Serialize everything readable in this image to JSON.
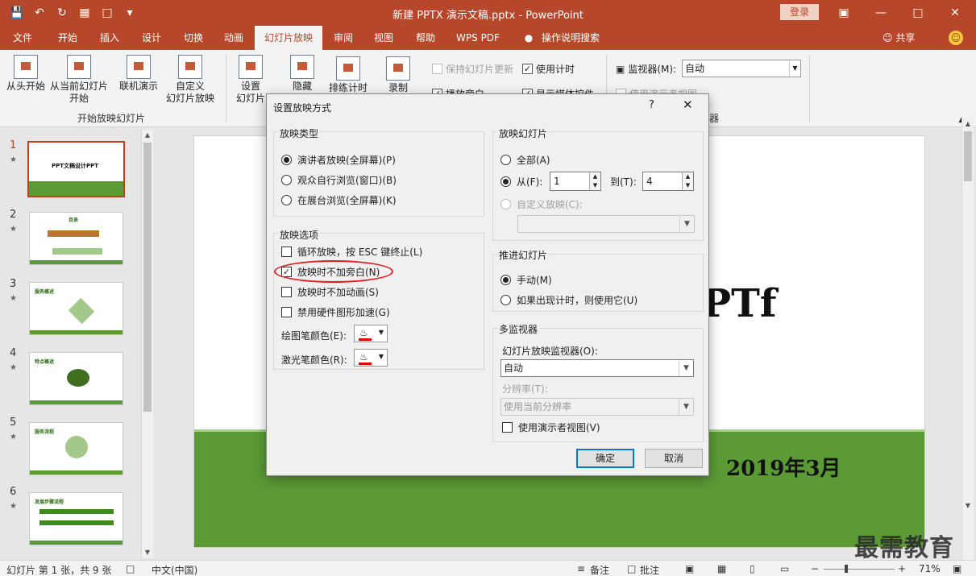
{
  "titlebar": {
    "title": "新建 PPTX 演示文稿.pptx - PowerPoint",
    "login": "登录"
  },
  "tabs": [
    "文件",
    "开始",
    "插入",
    "设计",
    "切换",
    "动画",
    "幻灯片放映",
    "审阅",
    "视图",
    "帮助",
    "WPS PDF",
    "操作说明搜索"
  ],
  "share": "共享",
  "ribbon": {
    "from_start": "从头开始",
    "from_current_1": "从当前幻灯片",
    "from_current_2": "开始",
    "online": "联机演示",
    "custom_1": "自定义",
    "custom_2": "幻灯片放映",
    "group_start": "开始放映幻灯片",
    "setup_1": "设置",
    "setup_2": "幻灯片",
    "hide": "隐藏",
    "rehearse": "排练计时",
    "record": "录制",
    "keep_updated": "保持幻灯片更新",
    "use_timings": "使用计时",
    "play_narration": "播放旁白",
    "show_media": "显示媒体控件",
    "monitor_label": "监视器(M):",
    "monitor_value": "自动",
    "presenter_view": "使用演示者视图",
    "group_monitor": "器"
  },
  "slides": [
    {
      "num": "1",
      "title": "PPT文稿设计PPT"
    },
    {
      "num": "2",
      "title": "目录"
    },
    {
      "num": "3",
      "title": "服务概述"
    },
    {
      "num": "4",
      "title": "特点概述"
    },
    {
      "num": "5",
      "title": "服务流程"
    },
    {
      "num": "6",
      "title": "发展步骤流程"
    }
  ],
  "slide": {
    "title_partial": "PTf",
    "date": "2019年3月"
  },
  "dialog": {
    "title": "设置放映方式",
    "help": "?",
    "show_type": {
      "legend": "放映类型",
      "opt1": "演讲者放映(全屏幕)(P)",
      "opt2": "观众自行浏览(窗口)(B)",
      "opt3": "在展台浏览(全屏幕)(K)"
    },
    "show_options": {
      "legend": "放映选项",
      "loop": "循环放映，按 ESC 键终止(L)",
      "no_narration": "放映时不加旁白(N)",
      "no_animation": "放映时不加动画(S)",
      "no_hw_accel": "禁用硬件图形加速(G)",
      "pen_color": "绘图笔颜色(E):",
      "laser_color": "激光笔颜色(R):"
    },
    "show_slides": {
      "legend": "放映幻灯片",
      "all": "全部(A)",
      "from": "从(F):",
      "from_value": "1",
      "to": "到(T):",
      "to_value": "4",
      "custom": "自定义放映(C):"
    },
    "advance": {
      "legend": "推进幻灯片",
      "manual": "手动(M)",
      "timings": "如果出现计时，则使用它(U)"
    },
    "multimonitor": {
      "legend": "多监视器",
      "monitor_label": "幻灯片放映监视器(O):",
      "monitor_value": "自动",
      "resolution_label": "分辨率(T):",
      "resolution_value": "使用当前分辨率",
      "presenter_view": "使用演示者视图(V)"
    },
    "ok": "确定",
    "cancel": "取消"
  },
  "statusbar": {
    "slide_info": "幻灯片 第 1 张，共 9 张",
    "language": "中文(中国)",
    "notes": "备注",
    "comments": "批注",
    "zoom": "71%"
  },
  "watermark": "最需教育"
}
